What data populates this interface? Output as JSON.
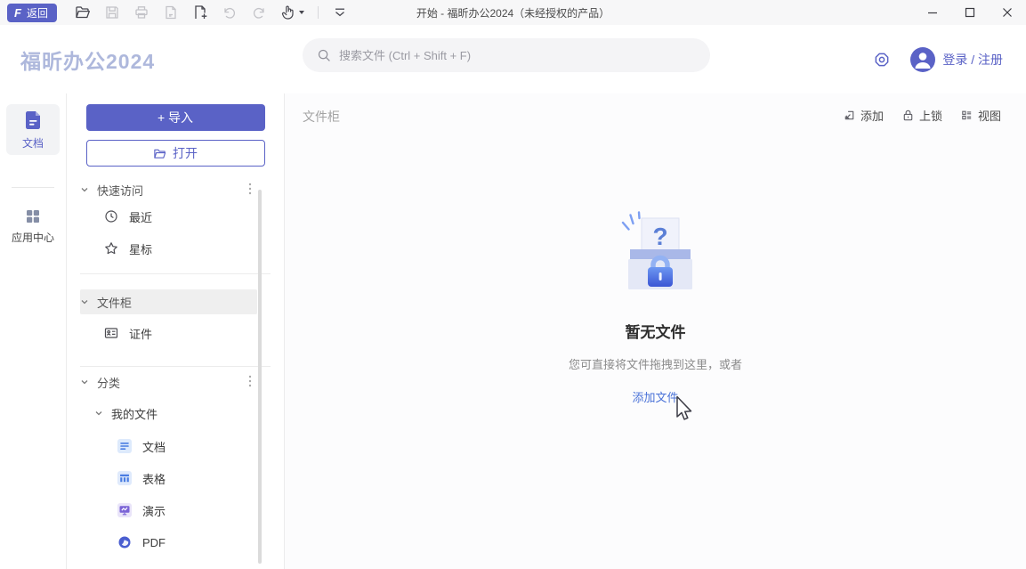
{
  "titlebar": {
    "back_logo": "F",
    "back_label": "返回",
    "window_title": "开始 - 福昕办公2024（未经授权的产品）"
  },
  "header": {
    "logo_text": "福昕办公2024",
    "search_placeholder": "搜索文件 (Ctrl + Shift + F)",
    "login_label": "登录 / 注册"
  },
  "rail": {
    "documents": "文档",
    "app_center": "应用中心"
  },
  "sidebar": {
    "import_label": "+ 导入",
    "open_label": "打开",
    "quick_access": "快速访问",
    "recent": "最近",
    "starred": "星标",
    "file_cabinet": "文件柜",
    "certificates": "证件",
    "categories": "分类",
    "my_files": "我的文件",
    "docs": "文档",
    "sheets": "表格",
    "slides": "演示",
    "pdf": "PDF"
  },
  "main": {
    "title": "文件柜",
    "add": "添加",
    "lock": "上锁",
    "view": "视图",
    "empty_qmark": "?",
    "empty_title": "暂无文件",
    "empty_desc": "您可直接将文件拖拽到这里，或者",
    "empty_action": "添加文件"
  },
  "colors": {
    "primary": "#5A62C6",
    "logo_blue": "#AEB8DC",
    "link_blue": "#4A72D8",
    "selected_bg": "#EFEFEF"
  }
}
